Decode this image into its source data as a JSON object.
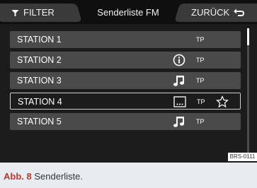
{
  "header": {
    "filter_label": "FILTER",
    "title": "Senderliste FM",
    "back_label": "ZURÜCK"
  },
  "stations": [
    {
      "name": "STATION 1",
      "tp": "TP",
      "icon": "",
      "selected": false
    },
    {
      "name": "STATION 2",
      "tp": "TP",
      "icon": "info-icon",
      "selected": false
    },
    {
      "name": "STATION 3",
      "tp": "TP",
      "icon": "music-note-icon",
      "selected": false
    },
    {
      "name": "STATION 4",
      "tp": "TP",
      "icon": "text-dots-icon",
      "selected": true
    },
    {
      "name": "STATION 5",
      "tp": "TP",
      "icon": "music-note-icon",
      "selected": false
    }
  ],
  "image_code": "BRS-0111",
  "caption": {
    "label": "Abb. 8",
    "text": "Senderliste."
  },
  "colors": {
    "background": "#1c1c1c",
    "row": "#4a4a4a",
    "accent": "#c0392b"
  }
}
